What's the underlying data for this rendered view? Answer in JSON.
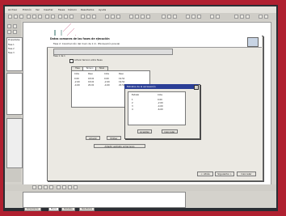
{
  "colors": {
    "frame_red": "#b02030",
    "window_gray": "#d4d2cc",
    "workspace": "#ffffff",
    "soil_pink": "#f2a0b4",
    "soil_green": "#3cb478",
    "soil_purple": "#a020a0",
    "soil_orange": "#f0a020",
    "soil_teal": "#2a9ea0"
  },
  "app": {
    "menu": [
      "Archivo",
      "Edición",
      "Ver",
      "Insertar",
      "Fases",
      "Cálculo",
      "Resultados",
      "Ayuda"
    ],
    "toolbar_icons": [
      "new-icon",
      "open-icon",
      "save-icon",
      "print-icon",
      "undo-icon",
      "redo-icon",
      "zoom-icon",
      "grid-icon"
    ],
    "left_panel": {
      "title": "Propiedades",
      "rows": [
        "Fase 1",
        "Fase 2",
        "Fase 3"
      ]
    }
  },
  "wizard": {
    "title": "Datos comunes de las fases de ejecución",
    "subtitle": "Fase 2: Construcción del muro de 1 m. (Excavación previa)",
    "phase_label": "Fase 1 de 1",
    "checkbox_label": "Activar terreno entre fases",
    "tabs": [
      "Fase",
      "Terreno",
      "Nivel"
    ],
    "table_header": [
      "Cota",
      "Peso",
      "Cota",
      "Peso"
    ],
    "table_rows": [
      [
        "0.00",
        "18.00",
        "0.00",
        "19.50"
      ],
      [
        "-2.00",
        "18.00",
        "-2.00",
        "19.50"
      ],
      [
        "-4.00",
        "20.00",
        "-4.00",
        "20.50"
      ]
    ],
    "buttons": {
      "add": "Añadir",
      "edit": "Editar",
      "delete": "Borrar",
      "assign": "Añadir estrato al terreno"
    },
    "footer": {
      "back": "< Atrás",
      "next": "Siguiente >",
      "cancel": "Cancelar"
    }
  },
  "subdialog": {
    "title": "Estratos de la excavación",
    "header": [
      "Estrato",
      "Cota"
    ],
    "rows": [
      [
        "1",
        "0.00"
      ],
      [
        "2",
        "-2.00"
      ],
      [
        "3",
        "-4.00"
      ],
      [
        "4",
        "-6.00"
      ]
    ],
    "ok": "Aceptar",
    "cancel": "Cancelar"
  },
  "bottom": {
    "tabs": [
      "Cimentación",
      "Muros",
      "Pantallas",
      "Resultados"
    ]
  }
}
